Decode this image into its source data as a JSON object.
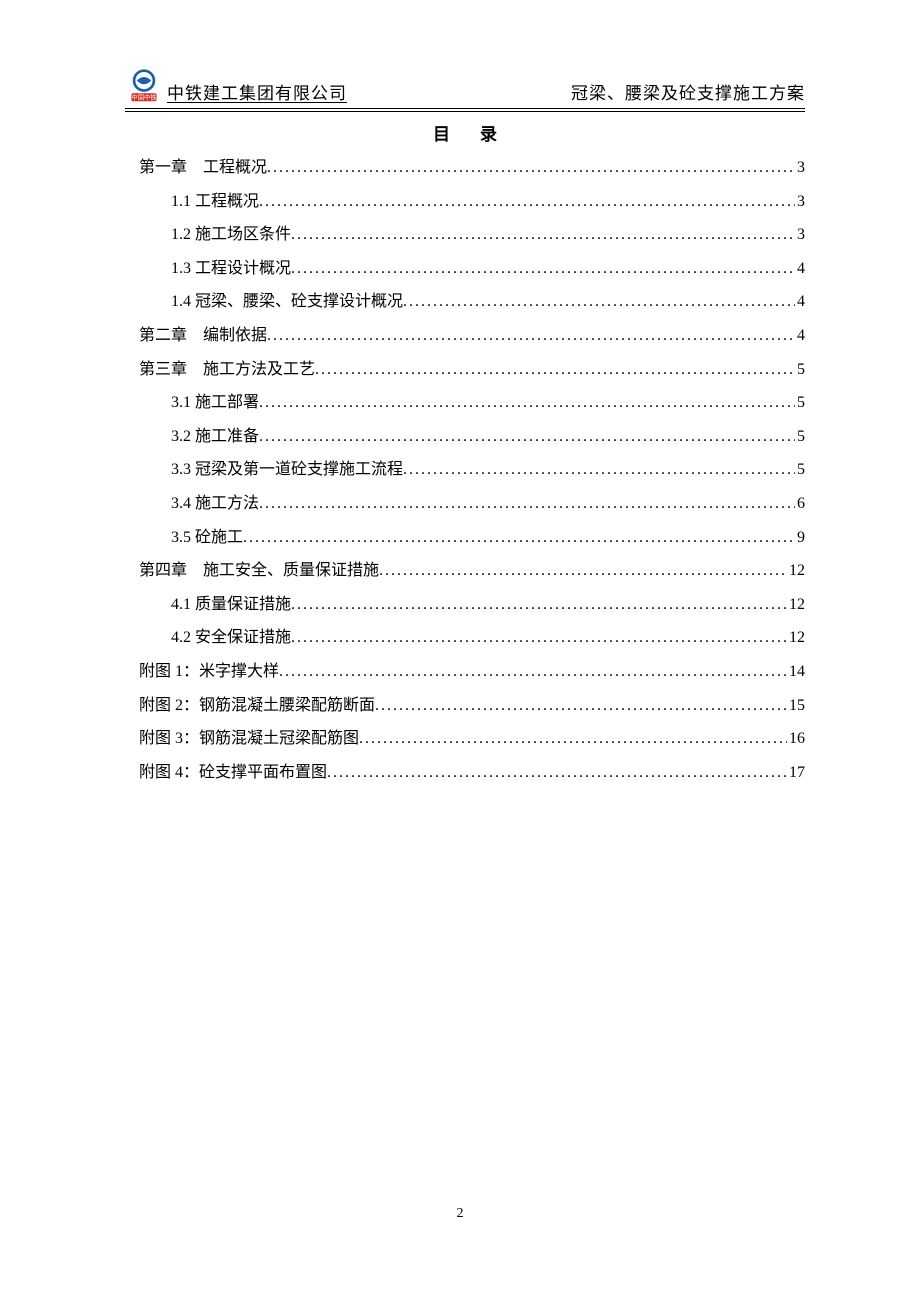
{
  "header": {
    "company": "中铁建工集团有限公司",
    "doc_title": "冠梁、腰梁及砼支撑施工方案",
    "logo_caption": "中国中铁"
  },
  "toc_title": "目录",
  "toc": [
    {
      "level": 1,
      "label": "第一章　工程概况",
      "page": "3"
    },
    {
      "level": 2,
      "label": "1.1 工程概况",
      "page": "3"
    },
    {
      "level": 2,
      "label": "1.2 施工场区条件",
      "page": "3"
    },
    {
      "level": 2,
      "label": "1.3 工程设计概况",
      "page": "4"
    },
    {
      "level": 2,
      "label": "1.4 冠梁、腰梁、砼支撑设计概况",
      "page": "4"
    },
    {
      "level": 1,
      "label": "第二章　编制依据",
      "page": "4"
    },
    {
      "level": 1,
      "label": "第三章　施工方法及工艺",
      "page": "5"
    },
    {
      "level": 2,
      "label": "3.1 施工部署",
      "page": "5"
    },
    {
      "level": 2,
      "label": "3.2 施工准备",
      "page": "5"
    },
    {
      "level": 2,
      "label": "3.3 冠梁及第一道砼支撑施工流程",
      "page": "5"
    },
    {
      "level": 2,
      "label": "3.4 施工方法",
      "page": "6"
    },
    {
      "level": 2,
      "label": "3.5 砼施工",
      "page": "9"
    },
    {
      "level": 1,
      "label": "第四章　施工安全、质量保证措施",
      "page": "12"
    },
    {
      "level": 2,
      "label": "4.1 质量保证措施",
      "page": "12"
    },
    {
      "level": 2,
      "label": "4.2 安全保证措施",
      "page": "12"
    },
    {
      "level": 1,
      "label": "附图 1：米字撑大样 ",
      "page": "14"
    },
    {
      "level": 1,
      "label": "附图 2：钢筋混凝土腰梁配筋断面 ",
      "page": "15"
    },
    {
      "level": 1,
      "label": "附图 3：钢筋混凝土冠梁配筋图 ",
      "page": "16"
    },
    {
      "level": 1,
      "label": "附图 4：砼支撑平面布置图 ",
      "page": "17"
    }
  ],
  "page_number": "2"
}
